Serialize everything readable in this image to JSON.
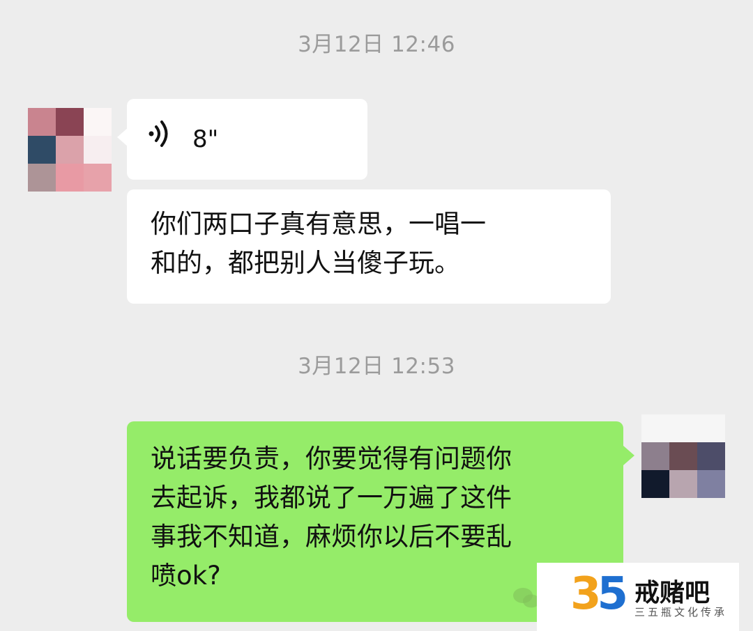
{
  "chat": {
    "timestamps": [
      "3月12日 12:46",
      "3月12日 12:53"
    ],
    "messages": [
      {
        "sender": "contact",
        "type": "voice",
        "duration": "8\""
      },
      {
        "sender": "contact",
        "type": "text",
        "lines": [
          "你们两口子真有意思，一唱一",
          "和的，都把别人当傻子玩。"
        ]
      },
      {
        "sender": "self",
        "type": "text",
        "lines": [
          "说话要负责，你要觉得有问题你",
          "去起诉，我都说了一万遍了这件",
          "事我不知道，麻烦你以后不要乱",
          "喷ok?"
        ]
      }
    ],
    "bubble_colors": {
      "incoming": "#ffffff",
      "outgoing": "#95ec69",
      "background": "#ededed"
    },
    "contact_avatar_colors": [
      "#c9848f",
      "#8a4454",
      "#fbf6f6",
      "#2f4b66",
      "#dba2aa",
      "#f7eef0",
      "#ad9497",
      "#e89aa4",
      "#e7a2aa"
    ],
    "self_avatar_colors": [
      "#f6f6f6",
      "#f6f6f6",
      "#f6f6f6",
      "#8d7f8d",
      "#6a4c53",
      "#4d4d69",
      "#111a2c",
      "#b8a5af",
      "#7f80a1"
    ]
  },
  "watermark": {
    "logo_number": "35",
    "title": "戒赌吧",
    "subtitle": "三五瓶文化传承",
    "colors": {
      "three": "#f2a21c",
      "five": "#1e6fd0"
    }
  }
}
